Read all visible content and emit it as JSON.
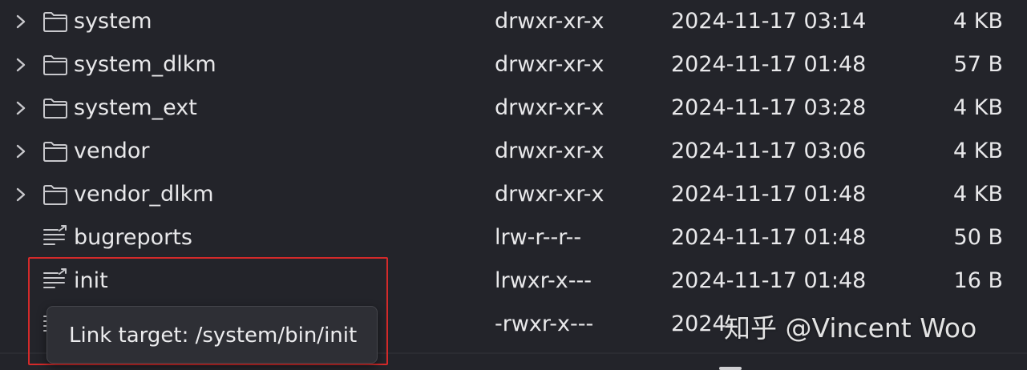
{
  "colors": {
    "background": "#23242a",
    "text": "#e8e8ea",
    "icon": "#c8c8cc",
    "highlight": "#d42a2a",
    "tooltip_bg": "#2e2f35"
  },
  "files": [
    {
      "name": "system",
      "perm": "drwxr-xr-x",
      "date": "2024-11-17 03:14",
      "size": "4 KB",
      "type": "folder",
      "icon": "folder-icon"
    },
    {
      "name": "system_dlkm",
      "perm": "drwxr-xr-x",
      "date": "2024-11-17 01:48",
      "size": "57 B",
      "type": "folder",
      "icon": "folder-icon"
    },
    {
      "name": "system_ext",
      "perm": "drwxr-xr-x",
      "date": "2024-11-17 03:28",
      "size": "4 KB",
      "type": "folder",
      "icon": "folder-icon"
    },
    {
      "name": "vendor",
      "perm": "drwxr-xr-x",
      "date": "2024-11-17 03:06",
      "size": "4 KB",
      "type": "folder",
      "icon": "folder-icon"
    },
    {
      "name": "vendor_dlkm",
      "perm": "drwxr-xr-x",
      "date": "2024-11-17 01:48",
      "size": "4 KB",
      "type": "folder",
      "icon": "folder-icon"
    },
    {
      "name": "bugreports",
      "perm": "lrw-r--r--",
      "date": "2024-11-17 01:48",
      "size": "50 B",
      "type": "symlink",
      "icon": "symlink-file-icon"
    },
    {
      "name": "init",
      "perm": "lrwxr-x---",
      "date": "2024-11-17 01:48",
      "size": "16 B",
      "type": "symlink",
      "icon": "symlink-file-icon"
    },
    {
      "name": "",
      "perm": "-rwxr-x---",
      "date": "2024-",
      "size": "",
      "type": "file",
      "icon": "file-icon"
    }
  ],
  "tooltip": {
    "text": "Link target: /system/bin/init"
  },
  "watermark": {
    "text": "知乎 @Vincent Woo"
  }
}
